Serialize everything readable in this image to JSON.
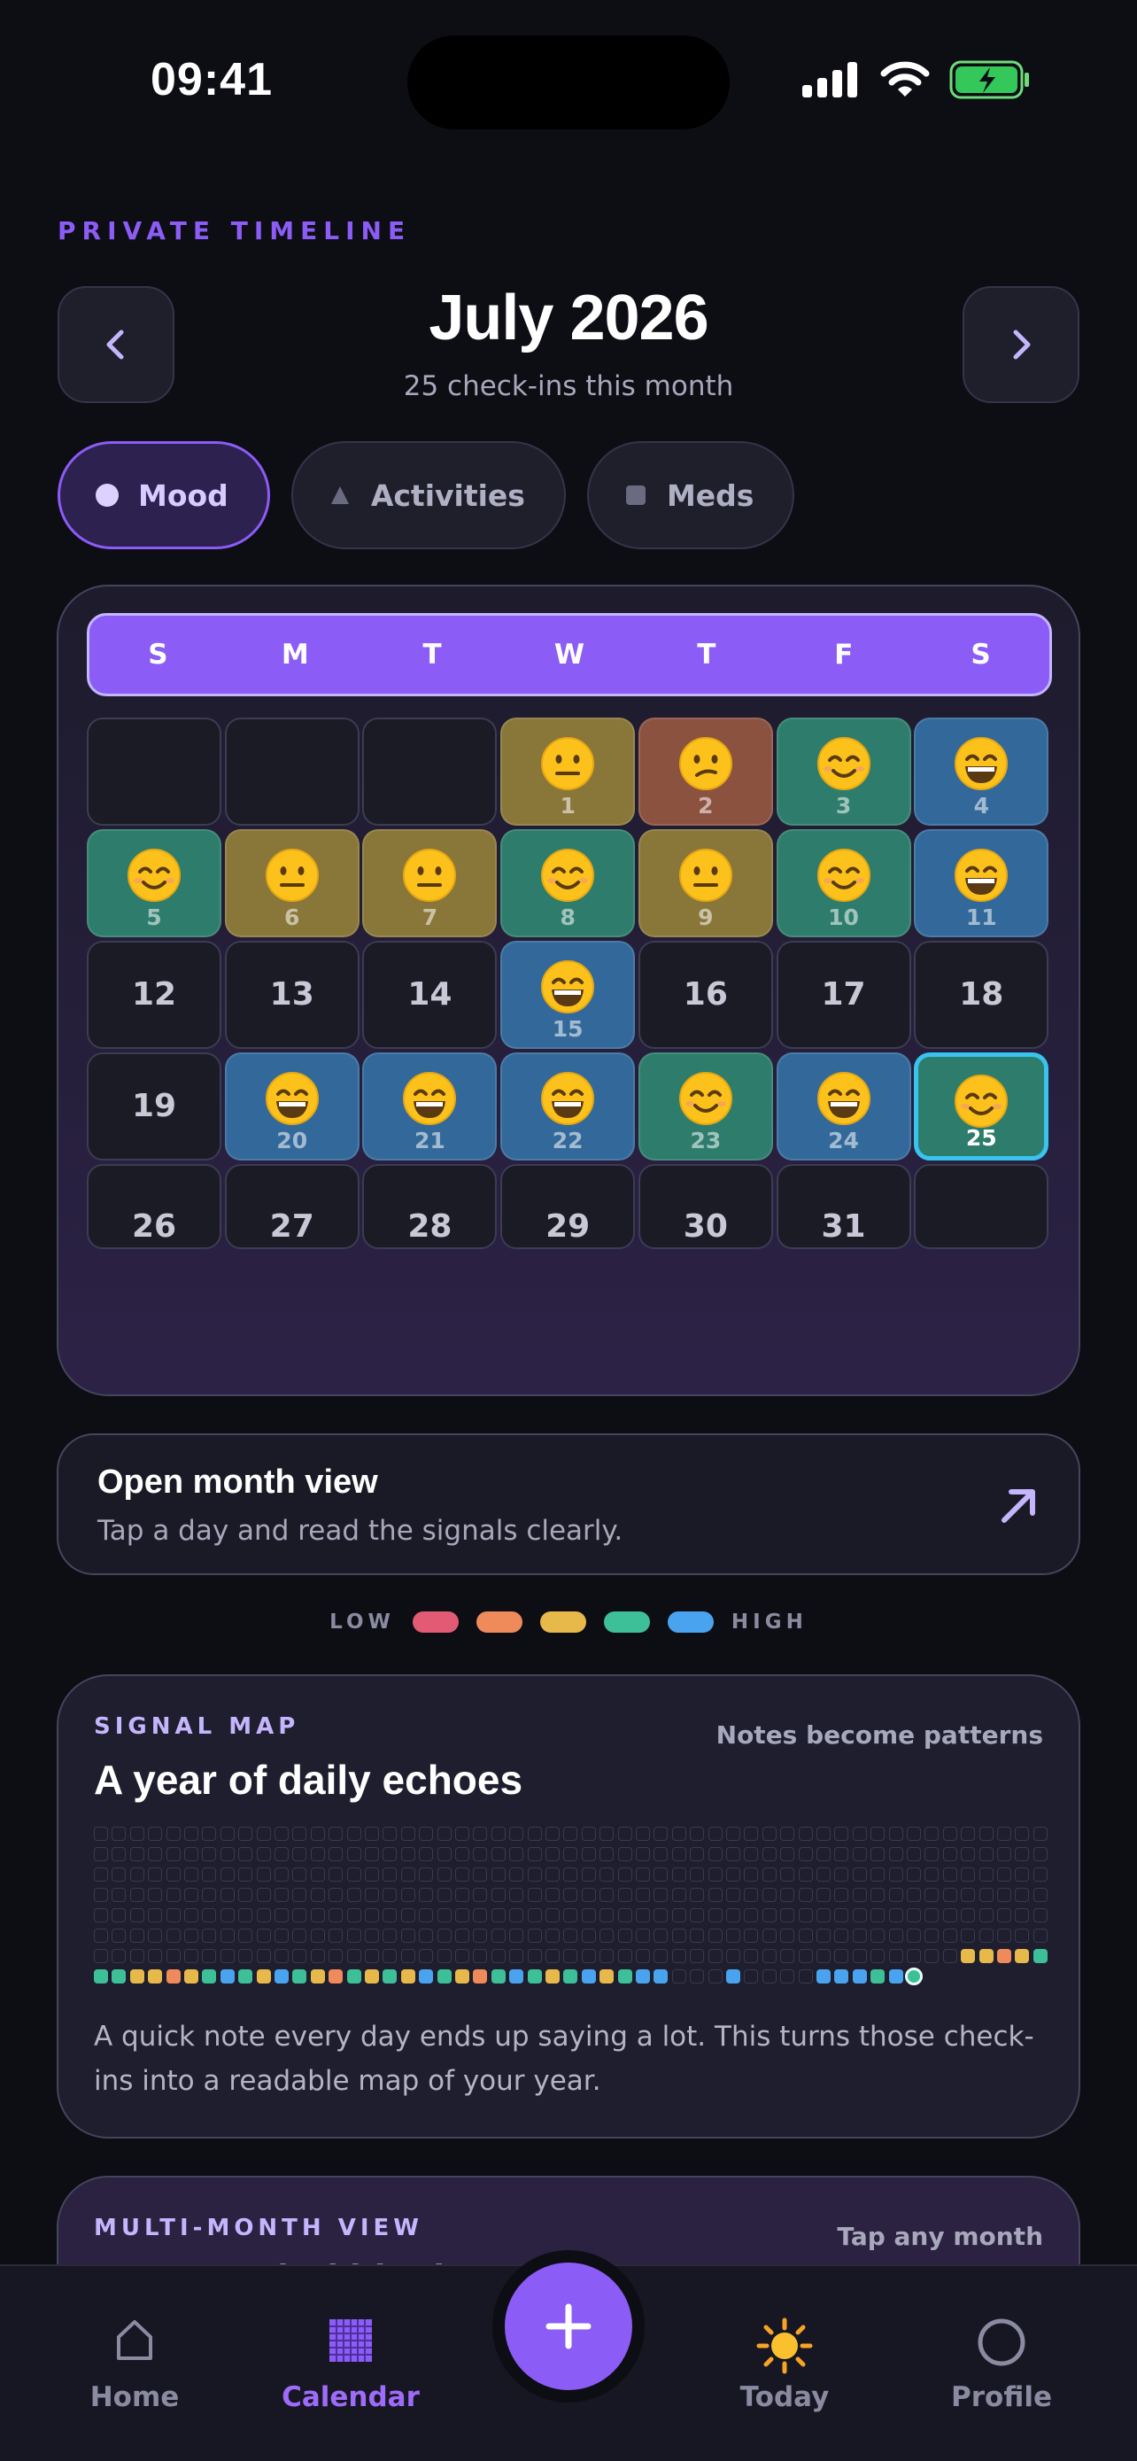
{
  "status": {
    "time": "09:41"
  },
  "header": {
    "eyebrow": "PRIVATE TIMELINE",
    "month": "July 2026",
    "subtitle": "25 check-ins this month"
  },
  "filters": [
    {
      "label": "Mood",
      "active": true,
      "icon": "circle-icon"
    },
    {
      "label": "Activities",
      "active": false,
      "icon": "triangle-icon"
    },
    {
      "label": "Meds",
      "active": false,
      "icon": "square-icon"
    }
  ],
  "calendar": {
    "weekdays": [
      "S",
      "M",
      "T",
      "W",
      "T",
      "F",
      "S"
    ],
    "days": [
      {
        "day": "1",
        "mood": "neutral-face-icon",
        "level": 3
      },
      {
        "day": "2",
        "mood": "confused-face-icon",
        "level": 2
      },
      {
        "day": "3",
        "mood": "smiling-face-icon",
        "level": 4
      },
      {
        "day": "4",
        "mood": "grinning-face-icon",
        "level": 5
      },
      {
        "day": "5",
        "mood": "smiling-face-icon",
        "level": 4
      },
      {
        "day": "6",
        "mood": "neutral-face-icon",
        "level": 3
      },
      {
        "day": "7",
        "mood": "neutral-face-icon",
        "level": 3
      },
      {
        "day": "8",
        "mood": "smiling-face-icon",
        "level": 4
      },
      {
        "day": "9",
        "mood": "neutral-face-icon",
        "level": 3
      },
      {
        "day": "10",
        "mood": "smiling-face-icon",
        "level": 4
      },
      {
        "day": "11",
        "mood": "grinning-face-icon",
        "level": 5
      },
      {
        "day": "12"
      },
      {
        "day": "13"
      },
      {
        "day": "14"
      },
      {
        "day": "15",
        "mood": "grinning-face-icon",
        "level": 5
      },
      {
        "day": "16"
      },
      {
        "day": "17"
      },
      {
        "day": "18"
      },
      {
        "day": "19"
      },
      {
        "day": "20",
        "mood": "grinning-face-icon",
        "level": 5
      },
      {
        "day": "21",
        "mood": "grinning-face-icon",
        "level": 5
      },
      {
        "day": "22",
        "mood": "grinning-face-icon",
        "level": 5
      },
      {
        "day": "23",
        "mood": "smiling-face-icon",
        "level": 4
      },
      {
        "day": "24",
        "mood": "grinning-face-icon",
        "level": 5
      },
      {
        "day": "25",
        "mood": "smiling-face-icon",
        "level": 4,
        "today": true
      },
      {
        "day": "26"
      },
      {
        "day": "27"
      },
      {
        "day": "28"
      },
      {
        "day": "29"
      },
      {
        "day": "30"
      },
      {
        "day": "31"
      }
    ]
  },
  "open_month": {
    "title": "Open month view",
    "subtitle": "Tap a day and read the signals clearly.",
    "icon": "arrow-up-right-icon"
  },
  "legend": {
    "low": "LOW",
    "high": "HIGH",
    "colors": [
      "#e35a74",
      "#ef8a5a",
      "#e7b84a",
      "#3dbf98",
      "#4aa3ee"
    ]
  },
  "signal_map": {
    "eyebrow": "SIGNAL MAP",
    "note": "Notes become patterns",
    "title": "A year of daily echoes",
    "description": "A quick note every day ends up saying a lot. This turns those check-ins into a readable map of your year.",
    "recent_levels": [
      4,
      4,
      3,
      3,
      2,
      3,
      4,
      5,
      4,
      3,
      5,
      4,
      3,
      2,
      4,
      3,
      4,
      3,
      5,
      4,
      3,
      2,
      4,
      5,
      4,
      3,
      4,
      5,
      3,
      4,
      5,
      5,
      0,
      0,
      0,
      5,
      0,
      0,
      0,
      0,
      5,
      5,
      5,
      4,
      5,
      4
    ],
    "tail_levels": [
      3,
      3,
      2,
      3,
      4
    ]
  },
  "multi_month": {
    "eyebrow": "MULTI-MONTH VIEW",
    "note": "Tap any month",
    "title": "Recent mind blocks"
  },
  "tabs": [
    {
      "label": "Home",
      "icon": "house-icon",
      "active": false
    },
    {
      "label": "Calendar",
      "icon": "calendar-grid-icon",
      "active": true
    },
    {
      "label": "Today",
      "icon": "sun-icon",
      "active": false
    },
    {
      "label": "Profile",
      "icon": "circle-outline-icon",
      "active": false
    }
  ],
  "fab": {
    "icon": "plus-icon"
  }
}
